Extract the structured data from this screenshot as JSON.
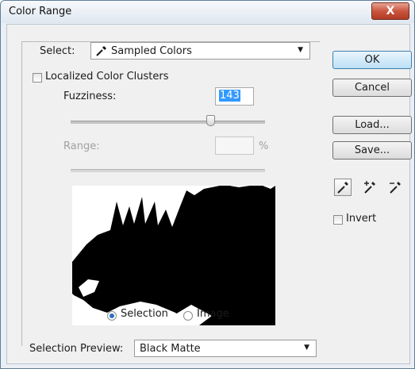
{
  "window": {
    "title": "Color Range",
    "close_glyph": "X"
  },
  "select": {
    "label": "Select:",
    "value": "Sampled Colors",
    "icon": "eyedropper-icon"
  },
  "localized": {
    "label": "Localized Color Clusters",
    "checked": false
  },
  "fuzziness": {
    "label": "Fuzziness:",
    "value": "143",
    "slider_fraction": 0.81
  },
  "range": {
    "label": "Range:",
    "value": "",
    "unit": "%"
  },
  "buttons": {
    "ok": "OK",
    "cancel": "Cancel",
    "load": "Load...",
    "save": "Save..."
  },
  "tools": [
    "eyedropper-icon",
    "eyedropper-plus-icon",
    "eyedropper-minus-icon"
  ],
  "invert": {
    "label": "Invert",
    "checked": false
  },
  "view": {
    "selection_label": "Selection",
    "image_label": "Image",
    "selected": "Selection"
  },
  "preview_mode": {
    "label": "Selection Preview:",
    "value": "Black Matte"
  },
  "colors": {
    "accent": "#3399ff",
    "close": "#c9553f",
    "ok_border": "#3c7fb1"
  }
}
